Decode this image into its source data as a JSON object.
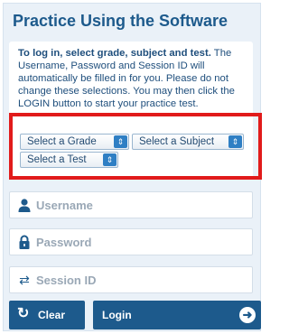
{
  "title": "Practice Using the Software",
  "instructions": {
    "bold": "To log in, select grade, subject and test.",
    "rest": "The Username, Password and Session ID will automatically be filled in for you. Please do not change these selections.",
    "cutoff_line": "You may then click the LOGIN button to start",
    "last_line": "your practice test."
  },
  "selects": {
    "grade": "Select a Grade",
    "subject": "Select a Subject",
    "test": "Select a Test"
  },
  "fields": {
    "username": "Username",
    "password": "Password",
    "session": "Session ID"
  },
  "buttons": {
    "clear": "Clear",
    "login": "Login"
  },
  "colors": {
    "brand": "#1d5a8c",
    "highlight": "#e11b1b",
    "panel": "#eaf1f8"
  },
  "icons": {
    "username": "user-icon",
    "password": "lock-icon",
    "session": "swap-arrows-icon",
    "clear": "refresh-icon",
    "login": "arrow-right-circle-icon",
    "select": "updown-chevron-icon"
  }
}
